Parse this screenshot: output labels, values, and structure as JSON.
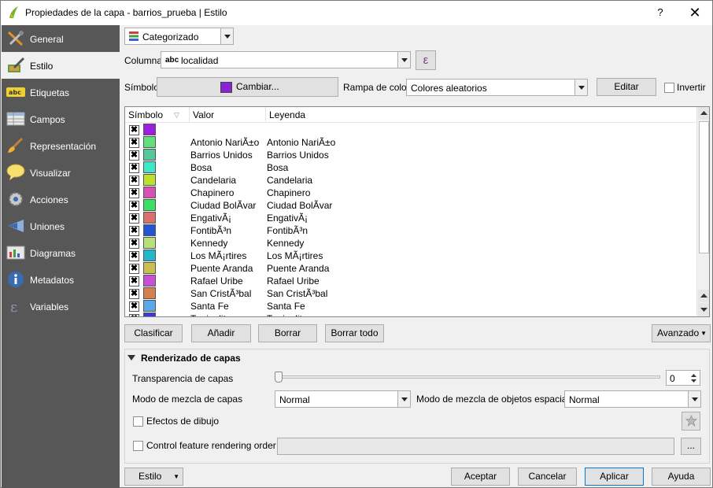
{
  "window": {
    "title": "Propiedades de la capa - barrios_prueba | Estilo",
    "help_label": "?",
    "close_label": "✕"
  },
  "sidebar": {
    "items": [
      {
        "label": "General",
        "icon": "tools-icon"
      },
      {
        "label": "Estilo",
        "icon": "style-brush-icon"
      },
      {
        "label": "Etiquetas",
        "icon": "abc-label-icon"
      },
      {
        "label": "Campos",
        "icon": "table-fields-icon"
      },
      {
        "label": "Representación",
        "icon": "paintbrush-icon"
      },
      {
        "label": "Visualizar",
        "icon": "speech-bubble-icon"
      },
      {
        "label": "Acciones",
        "icon": "gear-icon"
      },
      {
        "label": "Uniones",
        "icon": "join-icon"
      },
      {
        "label": "Diagramas",
        "icon": "diagram-icon"
      },
      {
        "label": "Metadatos",
        "icon": "info-icon"
      },
      {
        "label": "Variables",
        "icon": "epsilon-icon"
      }
    ]
  },
  "renderer": {
    "type_label": "Categorizado",
    "column_label": "Columna",
    "column_value": "localidad",
    "column_prefix": "abc",
    "expression_button": "ε",
    "symbol_label": "Símbolo",
    "change_button": "Cambiar...",
    "symbol_color": "#8c22d6",
    "ramp_label": "Rampa de color",
    "ramp_value": "Colores aleatorios",
    "edit_button": "Editar",
    "invert_label": "Invertir"
  },
  "table": {
    "headers": [
      "Símbolo",
      "Valor",
      "Leyenda"
    ],
    "check_mark": "✖",
    "rows": [
      {
        "value": "",
        "legend": "",
        "color": "#9b1fe0"
      },
      {
        "value": "Antonio NariÃ±o",
        "legend": "Antonio NariÃ±o",
        "color": "#5fe07a"
      },
      {
        "value": "Barrios Unidos",
        "legend": "Barrios Unidos",
        "color": "#56c99a"
      },
      {
        "value": "Bosa",
        "legend": "Bosa",
        "color": "#3de8c6"
      },
      {
        "value": "Candelaria",
        "legend": "Candelaria",
        "color": "#bde02c"
      },
      {
        "value": "Chapinero",
        "legend": "Chapinero",
        "color": "#d94fb5"
      },
      {
        "value": "Ciudad BolÃ­var",
        "legend": "Ciudad BolÃ­var",
        "color": "#3ce060"
      },
      {
        "value": "EngativÃ¡",
        "legend": "EngativÃ¡",
        "color": "#d9706b"
      },
      {
        "value": "FontibÃ³n",
        "legend": "FontibÃ³n",
        "color": "#2454d6"
      },
      {
        "value": "Kennedy",
        "legend": "Kennedy",
        "color": "#b6e07a"
      },
      {
        "value": "Los MÃ¡rtires",
        "legend": "Los MÃ¡rtires",
        "color": "#22b8c9"
      },
      {
        "value": "Puente Aranda",
        "legend": "Puente Aranda",
        "color": "#c9c04f"
      },
      {
        "value": "Rafael Uribe",
        "legend": "Rafael Uribe",
        "color": "#c94fd6"
      },
      {
        "value": "San CristÃ³bal",
        "legend": "San CristÃ³bal",
        "color": "#d6804f"
      },
      {
        "value": "Santa Fe",
        "legend": "Santa Fe",
        "color": "#5aa8e8"
      },
      {
        "value": "Tunjuelito",
        "legend": "Tunjuelito",
        "color": "#3a3ad6"
      }
    ]
  },
  "actions": {
    "classify": "Clasificar",
    "add": "Añadir",
    "delete": "Borrar",
    "delete_all": "Borrar todo",
    "advanced": "Avanzado"
  },
  "layer_rendering": {
    "title": "Renderizado de capas",
    "transparency_label": "Transparencia de capas",
    "transparency_value": "0",
    "blend_layer_label": "Modo de mezcla de capas",
    "blend_layer_value": "Normal",
    "blend_feature_label": "Modo de mezcla de objetos espaciales",
    "blend_feature_value": "Normal",
    "effects_label": "Efectos de dibujo",
    "order_label": "Control feature rendering order",
    "order_button": "..."
  },
  "footer": {
    "style": "Estilo",
    "accept": "Aceptar",
    "cancel": "Cancelar",
    "apply": "Aplicar",
    "help": "Ayuda"
  }
}
